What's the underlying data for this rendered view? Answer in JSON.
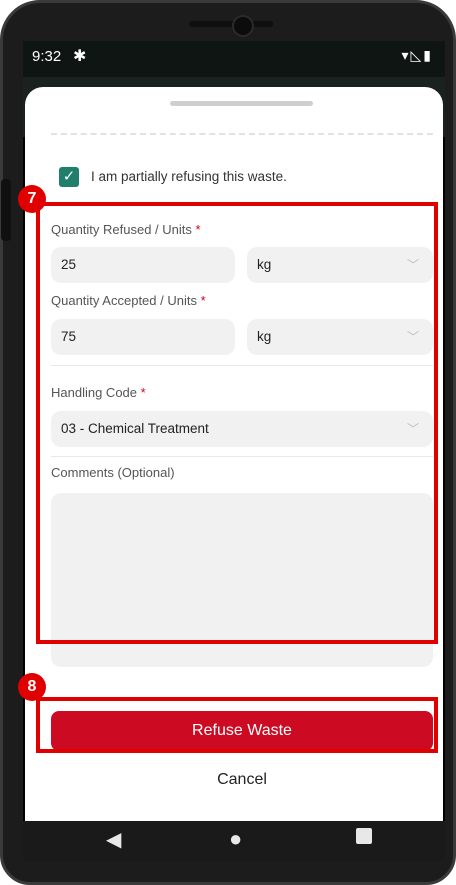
{
  "status_bar": {
    "time": "9:32",
    "gear_icon": "gear-icon",
    "right_icons": "▾◺▮"
  },
  "form": {
    "partial_refuse_label": "I am partially refusing this waste.",
    "partial_refuse_checked": true,
    "quantity_refused_label": "Quantity Refused / Units",
    "quantity_refused_value": "25",
    "quantity_refused_unit": "kg",
    "quantity_accepted_label": "Quantity Accepted / Units",
    "quantity_accepted_value": "75",
    "quantity_accepted_unit": "kg",
    "handling_code_label": "Handling Code",
    "handling_code_value": "03 - Chemical Treatment",
    "comments_label": "Comments (Optional)",
    "comments_value": "",
    "required_mark": "*"
  },
  "actions": {
    "refuse_label": "Refuse Waste",
    "cancel_label": "Cancel"
  },
  "callouts": {
    "form_badge": "7",
    "action_badge": "8"
  },
  "colors": {
    "accent_teal": "#1f7f6b",
    "primary_red": "#cc0a22",
    "callout_red": "#e00000"
  }
}
